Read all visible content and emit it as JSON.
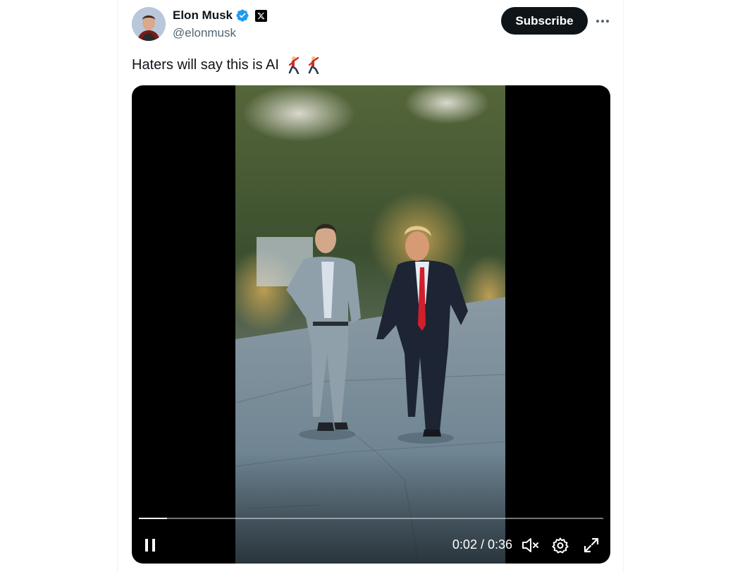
{
  "author": {
    "display_name": "Elon Musk",
    "handle": "@elonmusk",
    "verified_icon": "verified-badge-icon",
    "affiliation_icon": "x-logo-icon"
  },
  "actions": {
    "subscribe_label": "Subscribe",
    "more_icon": "more-horizontal-icon"
  },
  "post": {
    "text": "Haters will say this is AI",
    "emojis": [
      "man-dancing-emoji",
      "man-dancing-emoji"
    ]
  },
  "video": {
    "elapsed": "0:02",
    "duration": "0:36",
    "time_display": "0:02 / 0:36",
    "progress_fraction": 0.06,
    "controls": {
      "play_pause_icon": "pause-icon",
      "mute_icon": "volume-muted-icon",
      "settings_icon": "settings-gear-icon",
      "fullscreen_icon": "fullscreen-expand-icon"
    }
  },
  "colors": {
    "text_primary": "#0f1419",
    "text_secondary": "#536471",
    "verified_blue": "#1d9bf0",
    "button_dark": "#0f1419"
  }
}
